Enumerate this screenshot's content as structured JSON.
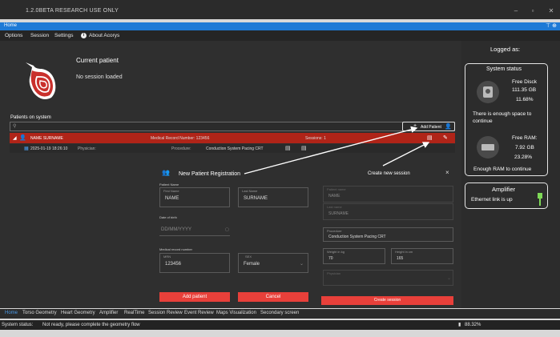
{
  "window": {
    "title": "1.2.0BETA  RESEARCH USE ONLY",
    "minimize": "–",
    "maximize": "▫",
    "close": "✕"
  },
  "bluebar": {
    "label": "Home",
    "pin": "⊤ ⊕"
  },
  "menu": {
    "options": "Options",
    "session": "Session",
    "settings": "Settings",
    "about": "About Acorys",
    "info_glyph": "i"
  },
  "current_patient": {
    "title": "Current patient",
    "status": "No session loaded"
  },
  "patients": {
    "section_label": "Patients on system",
    "add_patient": "Add Patient",
    "row": {
      "name": "NAME  SURNAME",
      "mrn": "Medical Record Number: 123456",
      "sessions": "Sessions: 1",
      "date": "2025-01-19 18:26:10",
      "physician": "Physician:",
      "procedure_label": "Procedure:",
      "procedure": "Conduction System Pacing CRT"
    }
  },
  "new_patient": {
    "title": "New Patient Registration",
    "patient_name_label": "Patient Name",
    "first_name_label": "First Name",
    "first_name": "NAME",
    "last_name_label": "Last Name",
    "last_name": "SURNAME",
    "dob_label": "Date of birth",
    "dob_placeholder": "DD/MM/YYYY",
    "mrn_label": "Medical record number",
    "mrn_sub_label": "MRN",
    "mrn": "123456",
    "sex_label": "SEX",
    "sex": "Female",
    "add_button": "Add patient",
    "cancel_button": "Cancel"
  },
  "new_session": {
    "title": "Create new session",
    "first_name_label": "Patient name",
    "first_name": "NAME",
    "last_name_label": "Last name",
    "last_name": "SURNAME",
    "procedure_label": "Procedure",
    "procedure": "Conduction System Pacing CRT",
    "weight_label": "Weight in kg",
    "weight": "70",
    "height_label": "Height in cm",
    "height": "165",
    "physician_label": "Physician",
    "create_button": "Create session",
    "close": "×"
  },
  "right_panel": {
    "logged_as": "Logged as:",
    "system_status_title": "System status",
    "free_disk_label": "Free Disck",
    "free_disk_value": "111.35 GB",
    "free_disk_pct": "11.68%",
    "disk_msg": "There is enough space to continue",
    "free_ram_label": "Free RAM:",
    "free_ram_value": "7.92 GB",
    "free_ram_pct": "23.28%",
    "ram_msg": "Enough RAM to continue",
    "amplifier_title": "Amplifier",
    "ethernet": "Ethernet link is up"
  },
  "tabs": [
    "Home",
    "Torso Geometry",
    "Heart Geometry",
    "Amplifier",
    "RealTime",
    "Session Review",
    "Event Review",
    "Maps Visualization",
    "Secondary screen"
  ],
  "statusbar": {
    "label": "System status:",
    "message": "Not ready, please complete the geometry flow",
    "battery": "88.32%"
  },
  "colors": {
    "accent_blue": "#1e7ad6",
    "row_red": "#b02418",
    "button_red": "#e8403a",
    "ethernet_green": "#7ed957"
  }
}
